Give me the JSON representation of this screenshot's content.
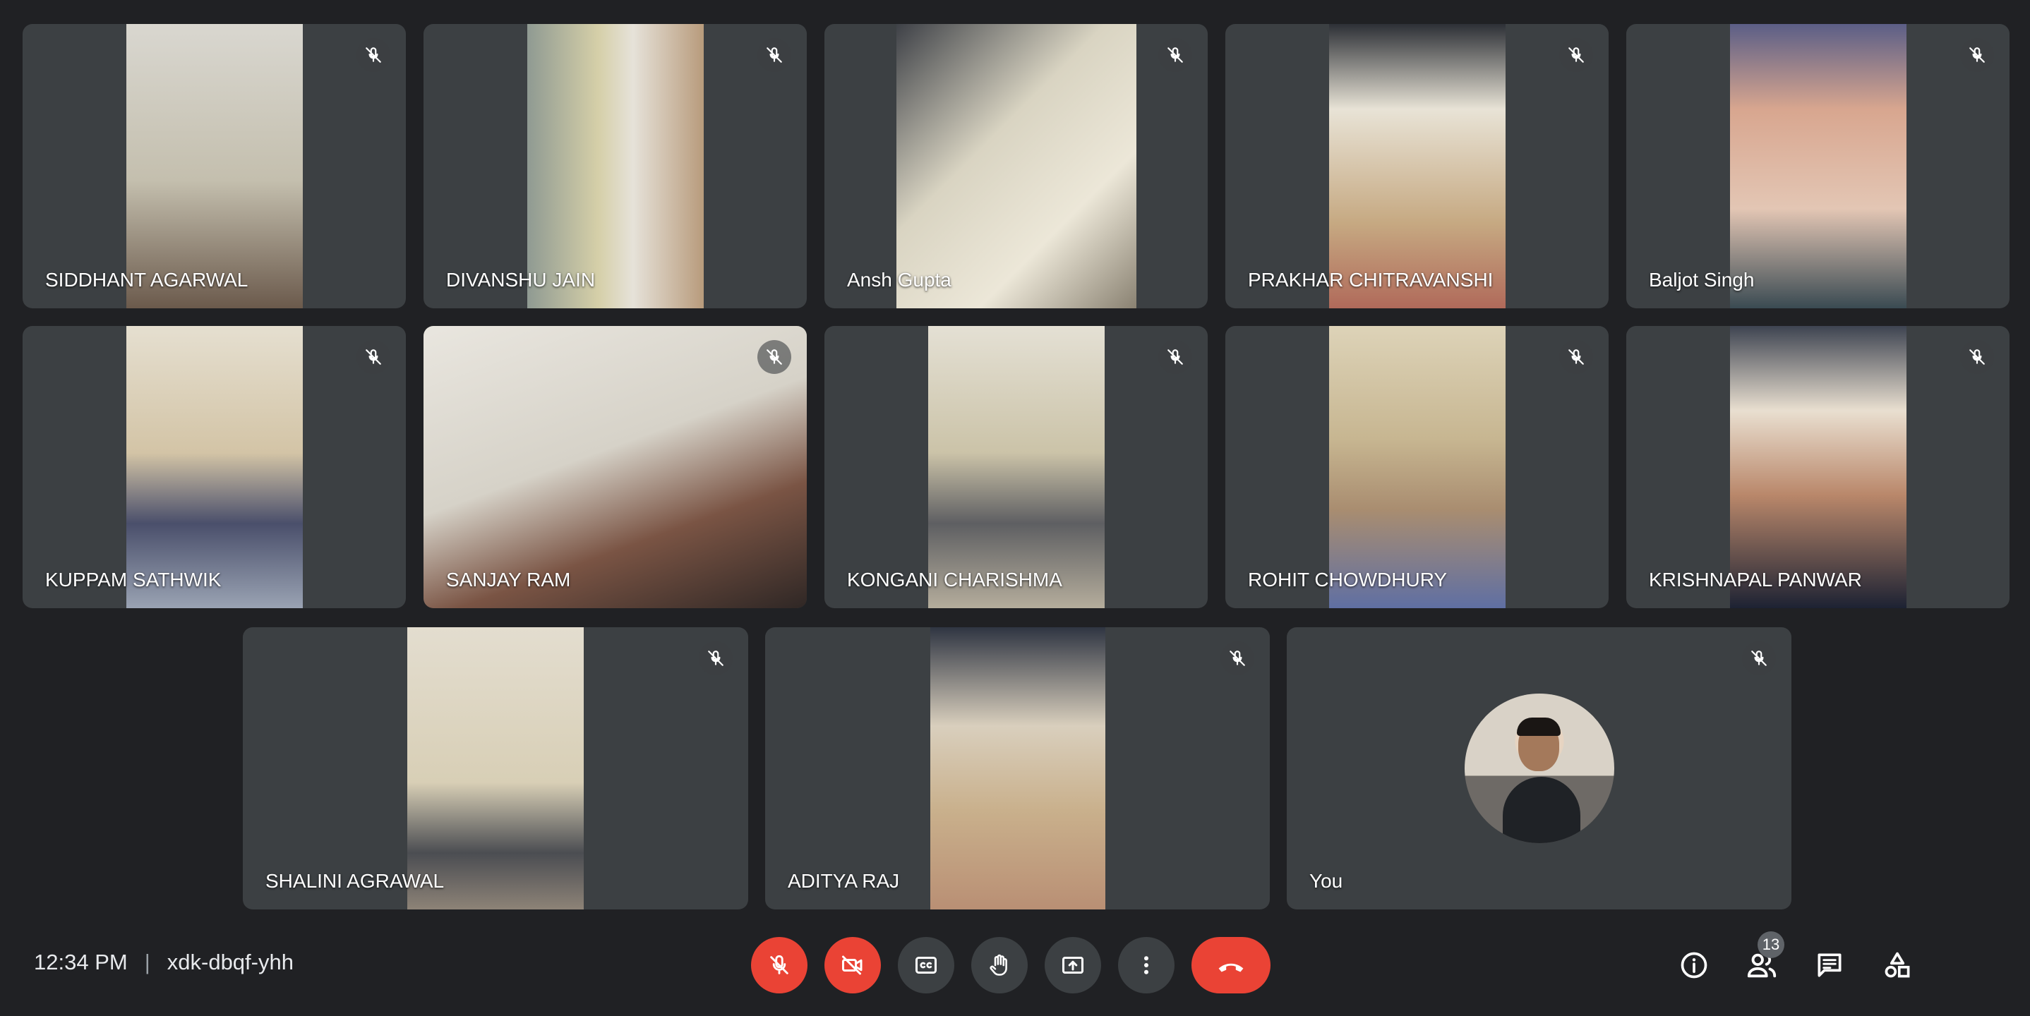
{
  "participants": [
    {
      "name": "SIDDHANT AGARWAL"
    },
    {
      "name": "DIVANSHU JAIN"
    },
    {
      "name": "Ansh Gupta"
    },
    {
      "name": "PRAKHAR CHITRAVANSHI"
    },
    {
      "name": "Baljot Singh"
    },
    {
      "name": "KUPPAM SATHWIK"
    },
    {
      "name": "SANJAY RAM"
    },
    {
      "name": "KONGANI CHARISHMA"
    },
    {
      "name": "ROHIT CHOWDHURY"
    },
    {
      "name": "KRISHNAPAL PANWAR"
    },
    {
      "name": "SHALINI AGRAWAL"
    },
    {
      "name": "ADITYA RAJ"
    },
    {
      "name": "You"
    }
  ],
  "meeting": {
    "time": "12:34 PM",
    "separator": "|",
    "code": "xdk-dbqf-yhh"
  },
  "people_count": "13",
  "controls": {
    "mic": "mic-off-icon",
    "camera": "camera-off-icon",
    "captions": "captions-icon",
    "raise_hand": "raise-hand-icon",
    "present": "present-screen-icon",
    "more": "more-options-icon",
    "leave": "leave-call-icon"
  },
  "colors": {
    "background": "#202124",
    "tile": "#3c4043",
    "danger": "#ea4335"
  }
}
